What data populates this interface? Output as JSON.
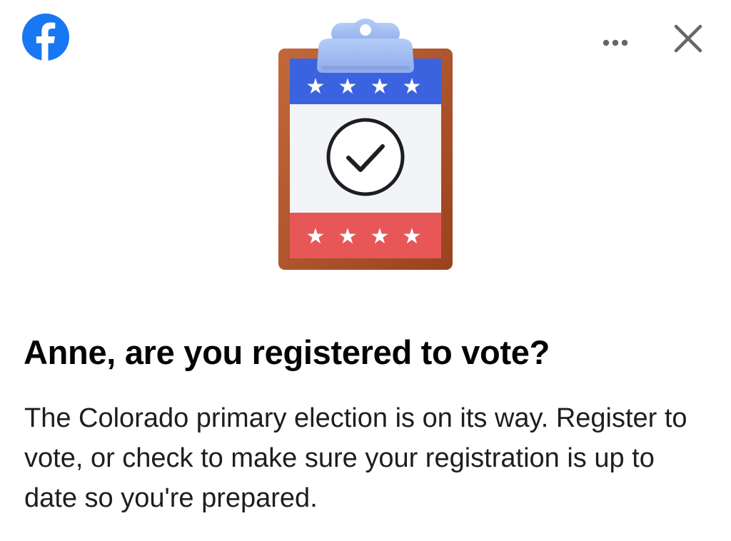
{
  "header": {
    "logo_icon": "facebook-logo-icon",
    "more_icon": "more-horizontal-icon",
    "close_icon": "close-icon"
  },
  "illustration": {
    "icon": "voting-clipboard-checkmark-icon",
    "colors": {
      "board": "#b5582c",
      "clip": "#9cb8f0",
      "blue_band": "#3b63e0",
      "red_band": "#e85757",
      "paper": "#f2f4f7"
    }
  },
  "headline": "Anne, are you registered to vote?",
  "body_text": "The Colorado primary election is on its way. Register to vote, or check to make sure your registration is up to date so you're prepared.",
  "colors": {
    "facebook_blue": "#1877f2",
    "text_primary": "#050505",
    "icon_gray": "#65676b"
  }
}
